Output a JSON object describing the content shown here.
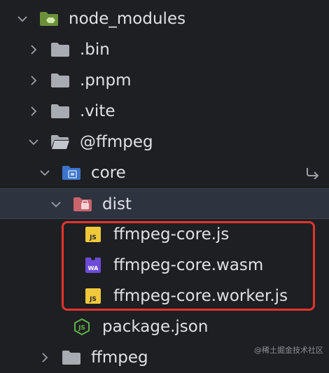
{
  "tree": {
    "items": [
      {
        "label": "node_modules",
        "kind": "folder-green"
      },
      {
        "label": ".bin",
        "kind": "folder"
      },
      {
        "label": ".pnpm",
        "kind": "folder"
      },
      {
        "label": ".vite",
        "kind": "folder"
      },
      {
        "label": "@ffmpeg",
        "kind": "folder-open"
      },
      {
        "label": "core",
        "kind": "folder-blue"
      },
      {
        "label": "dist",
        "kind": "folder-pink",
        "selected": true
      },
      {
        "label": "ffmpeg-core.js",
        "kind": "file-js",
        "badge": "JS"
      },
      {
        "label": "ffmpeg-core.wasm",
        "kind": "file-wasm",
        "badge": "WA"
      },
      {
        "label": "ffmpeg-core.worker.js",
        "kind": "file-js",
        "badge": "JS"
      },
      {
        "label": "package.json",
        "kind": "file-node"
      },
      {
        "label": "ffmpeg",
        "kind": "folder"
      }
    ]
  },
  "colors": {
    "background": "#1e1f22",
    "selected_row": "#2e3340",
    "highlight_border": "#e3342f",
    "js_badge": "#f0c93b",
    "wasm_badge": "#6c4bd8",
    "node_icon": "#5fb14b"
  },
  "watermark": "@稀土掘金技术社区"
}
